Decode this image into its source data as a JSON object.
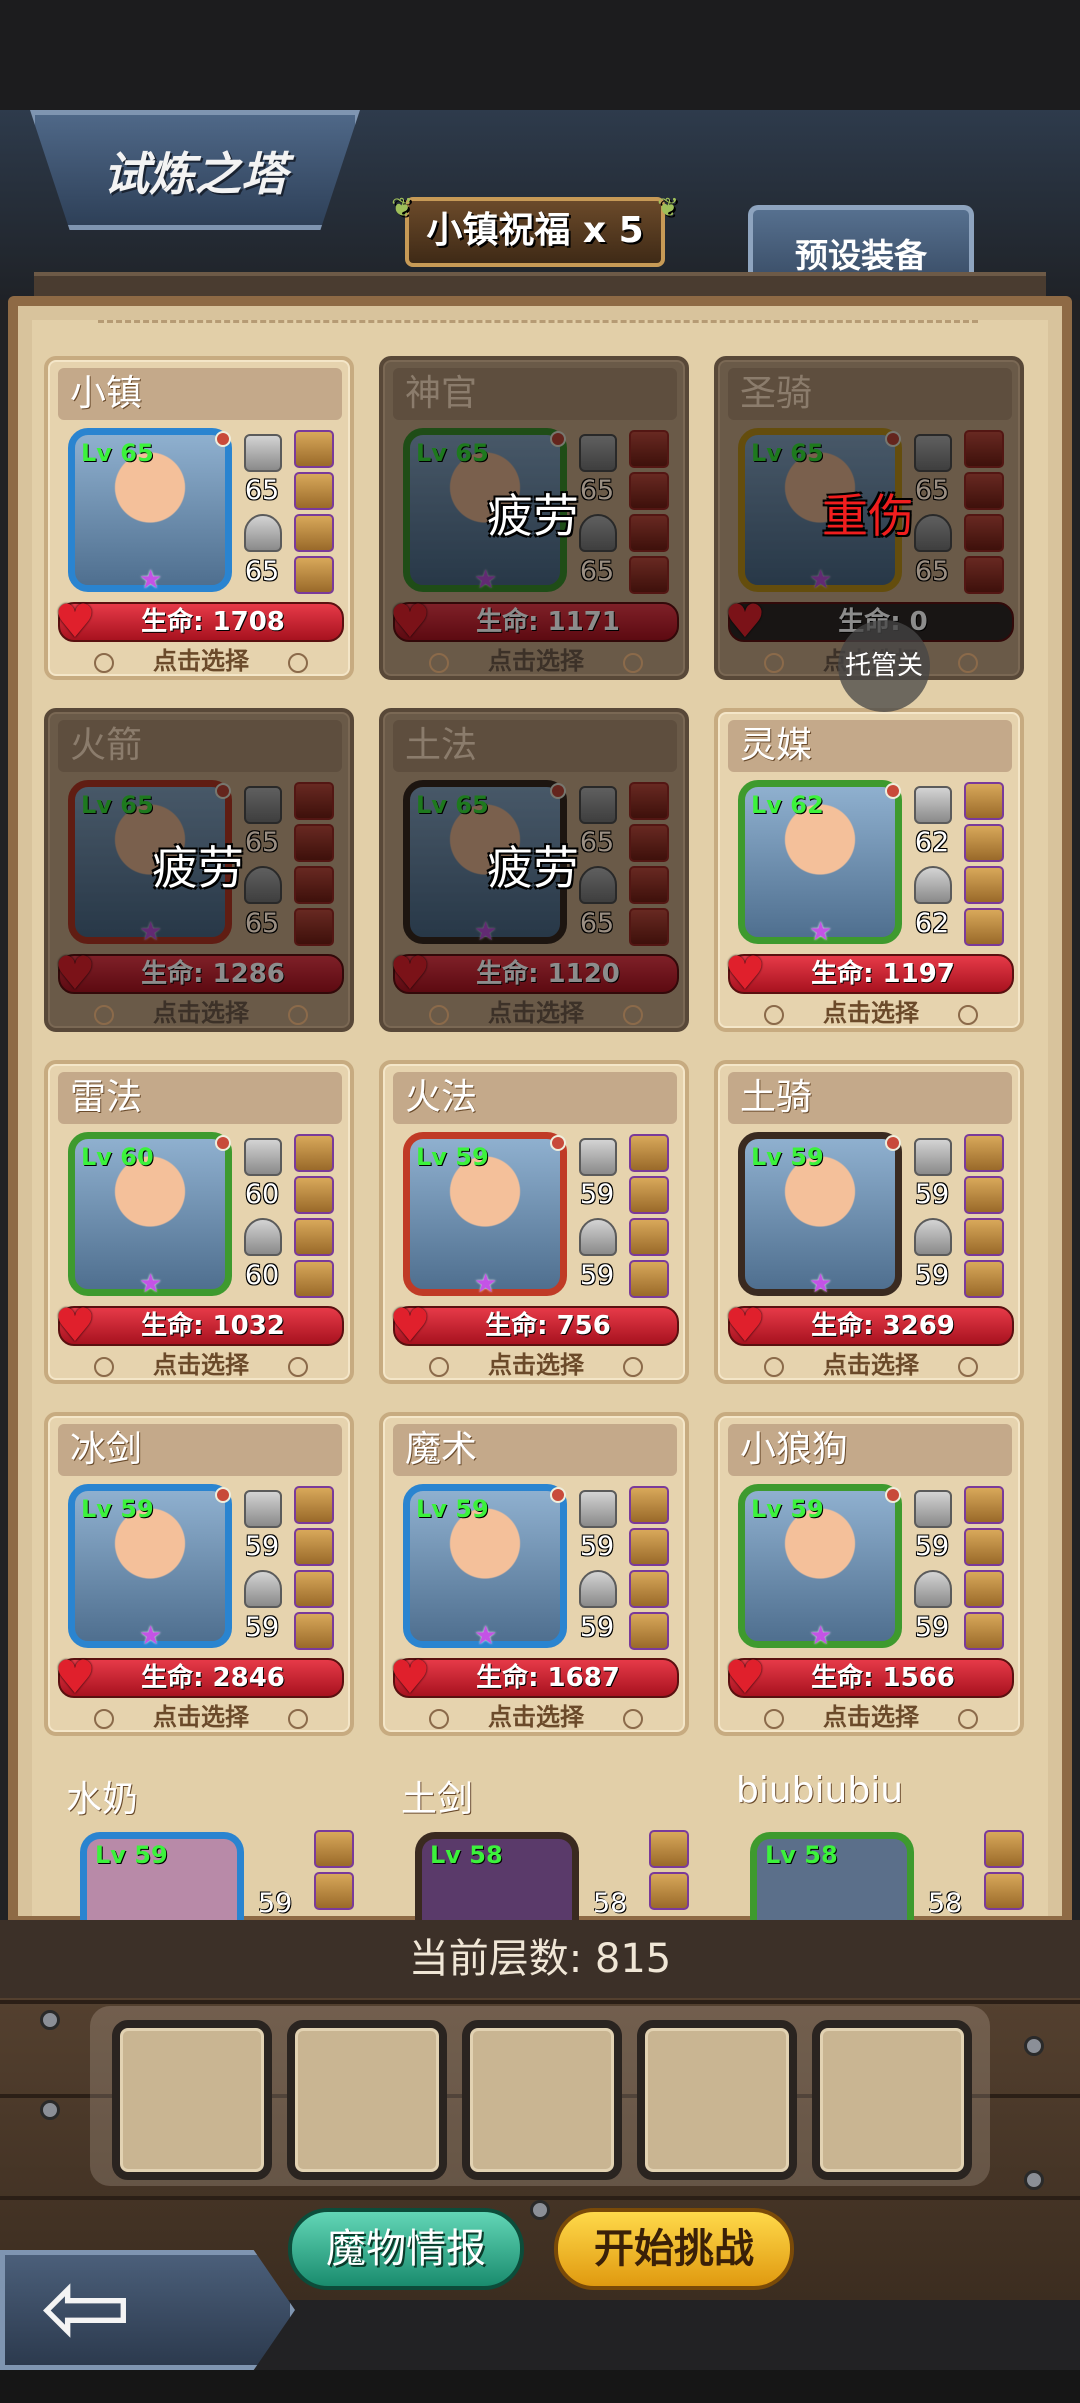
{
  "header": {
    "title": "试炼之塔",
    "blessing": "小镇祝福 x 5",
    "preset_tab": "预设装备"
  },
  "heroes": [
    {
      "name": "小镇",
      "level": "Lv 65",
      "weapon": "65",
      "armor": "65",
      "hp": "生命: 1708",
      "status": "",
      "frame": "blue",
      "dim": false,
      "select": "点击选择"
    },
    {
      "name": "神官",
      "level": "Lv 65",
      "weapon": "65",
      "armor": "65",
      "hp": "生命: 1171",
      "status": "疲劳",
      "frame": "green",
      "dim": true,
      "select": "点击选择"
    },
    {
      "name": "圣骑",
      "level": "Lv 65",
      "weapon": "65",
      "armor": "65",
      "hp": "生命: 0",
      "status": "重伤",
      "frame": "yellow",
      "dim": true,
      "select": "点击选择"
    },
    {
      "name": "火箭",
      "level": "Lv 65",
      "weapon": "65",
      "armor": "65",
      "hp": "生命: 1286",
      "status": "疲劳",
      "frame": "red",
      "dim": true,
      "select": "点击选择"
    },
    {
      "name": "土法",
      "level": "Lv 65",
      "weapon": "65",
      "armor": "65",
      "hp": "生命: 1120",
      "status": "疲劳",
      "frame": "dark",
      "dim": true,
      "select": "点击选择"
    },
    {
      "name": "灵媒",
      "level": "Lv 62",
      "weapon": "62",
      "armor": "62",
      "hp": "生命: 1197",
      "status": "",
      "frame": "green",
      "dim": false,
      "select": "点击选择"
    },
    {
      "name": "雷法",
      "level": "Lv 60",
      "weapon": "60",
      "armor": "60",
      "hp": "生命: 1032",
      "status": "",
      "frame": "green",
      "dim": false,
      "select": "点击选择"
    },
    {
      "name": "火法",
      "level": "Lv 59",
      "weapon": "59",
      "armor": "59",
      "hp": "生命: 756",
      "status": "",
      "frame": "red",
      "dim": false,
      "select": "点击选择"
    },
    {
      "name": "土骑",
      "level": "Lv 59",
      "weapon": "59",
      "armor": "59",
      "hp": "生命: 3269",
      "status": "",
      "frame": "dark",
      "dim": false,
      "select": "点击选择"
    },
    {
      "name": "冰剑",
      "level": "Lv 59",
      "weapon": "59",
      "armor": "59",
      "hp": "生命: 2846",
      "status": "",
      "frame": "blue",
      "dim": false,
      "select": "点击选择"
    },
    {
      "name": "魔术",
      "level": "Lv 59",
      "weapon": "59",
      "armor": "59",
      "hp": "生命: 1687",
      "status": "",
      "frame": "blue",
      "dim": false,
      "select": "点击选择"
    },
    {
      "name": "小狼狗",
      "level": "Lv 59",
      "weapon": "59",
      "armor": "59",
      "hp": "生命: 1566",
      "status": "",
      "frame": "green",
      "dim": false,
      "select": "点击选择"
    }
  ],
  "partial_heroes": [
    {
      "name": "水奶",
      "level": "Lv 59",
      "weapon": "59"
    },
    {
      "name": "土剑",
      "level": "Lv 58",
      "weapon": "58"
    },
    {
      "name": "biubiubiu",
      "level": "Lv 58",
      "weapon": "58"
    }
  ],
  "auto_button": "托管关",
  "floor_label": "当前层数: 815",
  "buttons": {
    "monster_info": "魔物情报",
    "start_challenge": "开始挑战"
  }
}
